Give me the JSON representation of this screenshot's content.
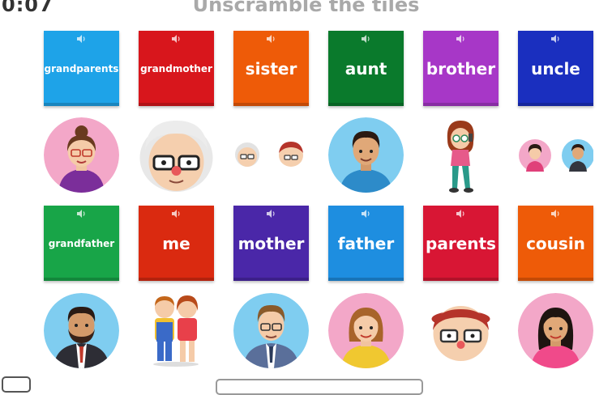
{
  "header": {
    "timer": "0:07",
    "title": "Unscramble the tiles"
  },
  "tiles_row1": [
    {
      "label": "grandparents",
      "color": "#1ea3e8",
      "small": true
    },
    {
      "label": "grandmother",
      "color": "#d8161c",
      "small": true
    },
    {
      "label": "sister",
      "color": "#ee5b08",
      "small": false
    },
    {
      "label": "aunt",
      "color": "#0a7a2c",
      "small": false
    },
    {
      "label": "brother",
      "color": "#a737c7",
      "small": false
    },
    {
      "label": "uncle",
      "color": "#1a2fbf",
      "small": false
    }
  ],
  "tiles_row2": [
    {
      "label": "grandfather",
      "color": "#18a548",
      "small": true
    },
    {
      "label": "me",
      "color": "#da2a10",
      "small": false
    },
    {
      "label": "mother",
      "color": "#4a27a8",
      "small": false
    },
    {
      "label": "father",
      "color": "#1e8ee0",
      "small": false
    },
    {
      "label": "parents",
      "color": "#d81634",
      "small": false
    },
    {
      "label": "cousin",
      "color": "#ee5b08",
      "small": false
    }
  ],
  "icons": {
    "tile_audio": "speaker-icon"
  }
}
